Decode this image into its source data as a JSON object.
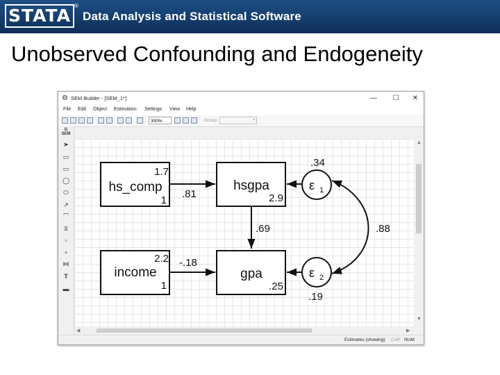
{
  "header": {
    "logo_text": "STATA",
    "logo_mark": "®",
    "tagline": "Data Analysis and Statistical Software"
  },
  "slide": {
    "title": "Unobserved Confounding and Endogeneity"
  },
  "window": {
    "title": "SEM Builder - [SEM_1*]",
    "controls": {
      "minimize": "—",
      "maximize": "☐",
      "close": "✕"
    }
  },
  "menu": [
    "File",
    "Edit",
    "Object",
    "Estimation",
    "Settings",
    "View",
    "Help"
  ],
  "toolbar": {
    "zoom_value": "300%",
    "group_label": "Group:"
  },
  "left_toolbar": {
    "gsem_label": "G\nSEM"
  },
  "diagram": {
    "nodes": {
      "hs_comp": {
        "label": "hs_comp",
        "top_value": "1.7",
        "bottom_value": "1"
      },
      "hsgpa": {
        "label": "hsgpa",
        "value": "2.9"
      },
      "income": {
        "label": "income",
        "top_value": "2.2",
        "bottom_value": "1"
      },
      "gpa": {
        "label": "gpa",
        "value": ".25"
      },
      "e1": {
        "label": "ε",
        "sub": "1",
        "variance": ".34"
      },
      "e2": {
        "label": "ε",
        "sub": "2",
        "variance": ".19"
      }
    },
    "paths": {
      "hs_comp_to_hsgpa": ".81",
      "income_to_gpa": "-.18",
      "hsgpa_to_gpa": ".69",
      "e1_e2_covariance": ".88"
    }
  },
  "status": {
    "estimates": "Estimates (showing)",
    "cap": "CAP",
    "num": "NUM"
  },
  "colors": {
    "banner": "#153d6c",
    "canvas_grid": "#e6e6e6"
  }
}
